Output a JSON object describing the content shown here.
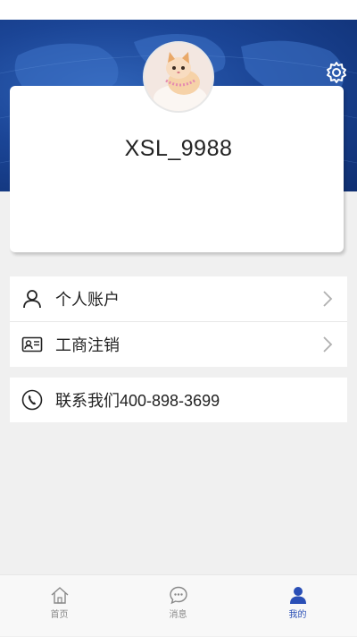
{
  "profile": {
    "username": "XSL_9988"
  },
  "menu": [
    {
      "id": "personal-account",
      "label": "个人账户",
      "icon": "person-icon"
    },
    {
      "id": "business-deregistration",
      "label": "工商注销",
      "icon": "id-card-icon"
    }
  ],
  "contact": {
    "label": "联系我们400-898-3699",
    "icon": "phone-icon"
  },
  "tabs": [
    {
      "label": "首页",
      "icon": "home-icon",
      "active": false
    },
    {
      "label": "消息",
      "icon": "message-icon",
      "active": false
    },
    {
      "label": "我的",
      "icon": "user-icon",
      "active": true
    }
  ],
  "colors": {
    "accent": "#2a4fb6",
    "hero": "#1b4596",
    "background": "#f0f0f0"
  }
}
